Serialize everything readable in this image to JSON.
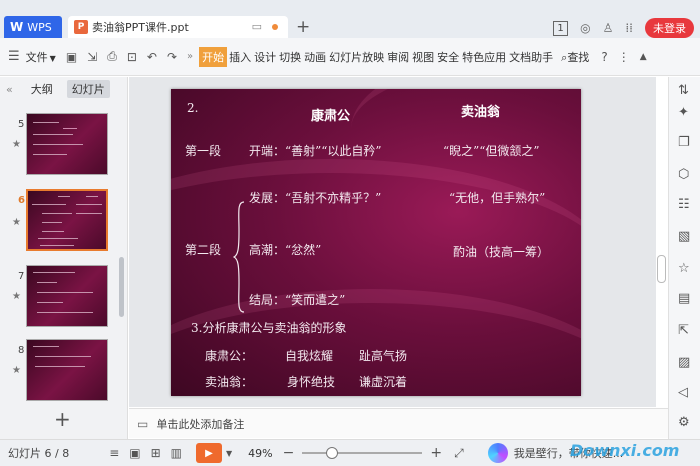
{
  "titlebar": {
    "app_tab": "WPS",
    "doc_tab": "卖油翁PPT课件.ppt",
    "badge": "1",
    "login": "未登录"
  },
  "toolbar": {
    "file_menu": "文件",
    "tabs": [
      {
        "label": "开始",
        "active": true
      },
      {
        "label": "插入"
      },
      {
        "label": "设计"
      },
      {
        "label": "切换"
      },
      {
        "label": "动画"
      },
      {
        "label": "幻灯片放映"
      },
      {
        "label": "审阅"
      },
      {
        "label": "视图"
      },
      {
        "label": "安全"
      },
      {
        "label": "特色应用"
      },
      {
        "label": "文档助手"
      }
    ],
    "search": "查找"
  },
  "leftpanel": {
    "outline_tab": "大纲",
    "slides_tab": "幻灯片",
    "thumbnails": [
      {
        "number": "5"
      },
      {
        "number": "6",
        "active": true
      },
      {
        "number": "7"
      },
      {
        "number": "8"
      }
    ]
  },
  "slide": {
    "number": "2.",
    "col1_header": "康肃公",
    "col2_header": "卖油翁",
    "section1_label": "第一段",
    "s1_left": "开端：“善射”“以此自矜”",
    "s1_right": "“睨之”“但微颔之”",
    "section2_label": "第二段",
    "s2_dev": "发展：“吾射不亦精乎？”",
    "s2_dev_right": "“无他，但手熟尔”",
    "s2_climax": "高潮：“忿然”",
    "s2_climax_right": "酌油（技高一筹）",
    "s2_end": "结局：“笑而遣之”",
    "analysis_title": "3.分析康肃公与卖油翁的形象",
    "ks_name": "康肃公：",
    "ks_trait1": "自我炫耀",
    "ks_trait2": "趾高气扬",
    "my_name": "卖油翁：",
    "my_trait1": "身怀绝技",
    "my_trait2": "谦虚沉着"
  },
  "notes": {
    "placeholder": "单击此处添加备注"
  },
  "status": {
    "slide_count": "幻灯片 6 / 8",
    "zoom": "49%",
    "zoom_fraction": 0.22,
    "assistant": "我是壁行，带你快速..."
  },
  "watermark": "Downxi.com",
  "colors": {
    "accent": "#ef6a2d",
    "active_tab": "#f0a03c",
    "login": "#e8383d",
    "wps_blue": "#2f66e8",
    "slide_bg": "#6b0f3c"
  }
}
